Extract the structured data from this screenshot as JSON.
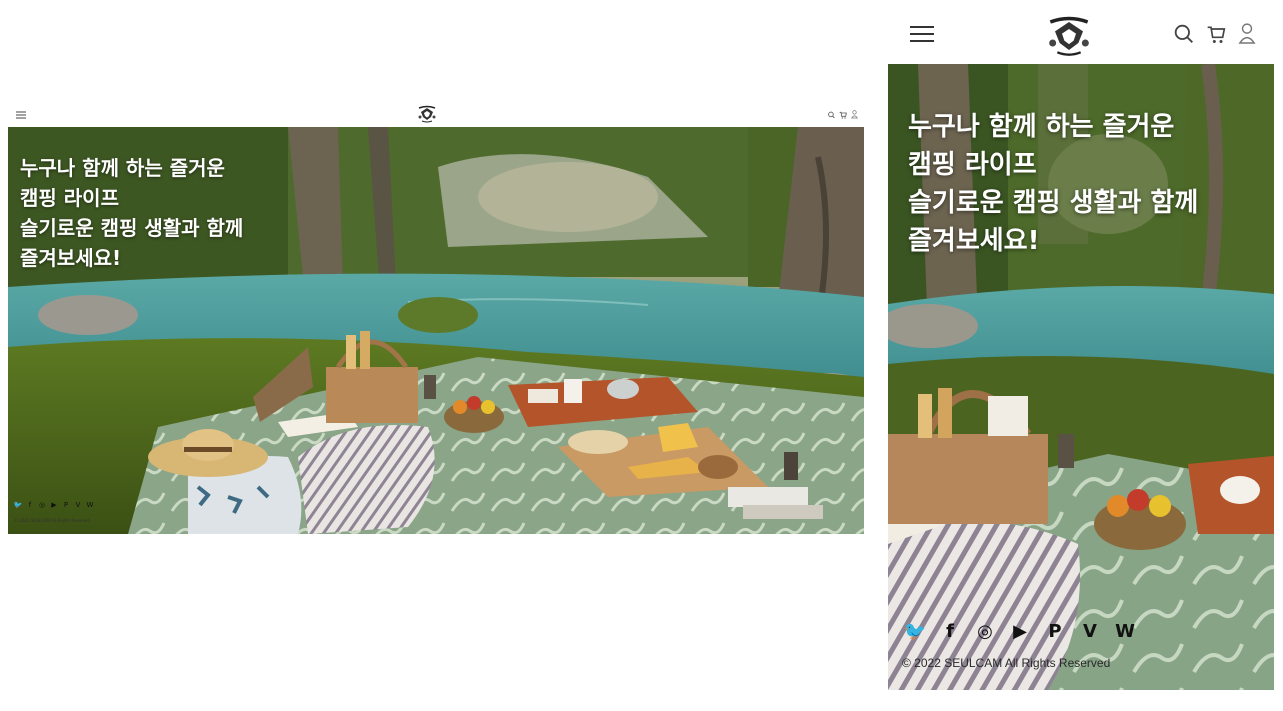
{
  "hero": {
    "lines": [
      "누구나 함께 하는 즐거운",
      "캠핑 라이프",
      "슬기로운 캠핑 생활과 함께",
      "즐겨보세요!"
    ]
  },
  "header": {
    "menu_icon": "hamburger-menu-icon",
    "logo": "seulcam-logo",
    "right_icons": [
      "search-icon",
      "cart-icon",
      "user-icon"
    ]
  },
  "social": {
    "icons": [
      "twitter-icon",
      "facebook-icon",
      "instagram-icon",
      "youtube-icon",
      "pinterest-icon",
      "vimeo-icon",
      "weibo-icon"
    ],
    "glyphs": [
      "🐦",
      "f",
      "◎",
      "▶",
      "P",
      "V",
      "W"
    ]
  },
  "footer": {
    "copyright": "© 2022 SEULCAM All Rights Reserved"
  },
  "colors": {
    "background": "#ffffff",
    "hero_text": "#ffffff",
    "icon": "#333333"
  }
}
